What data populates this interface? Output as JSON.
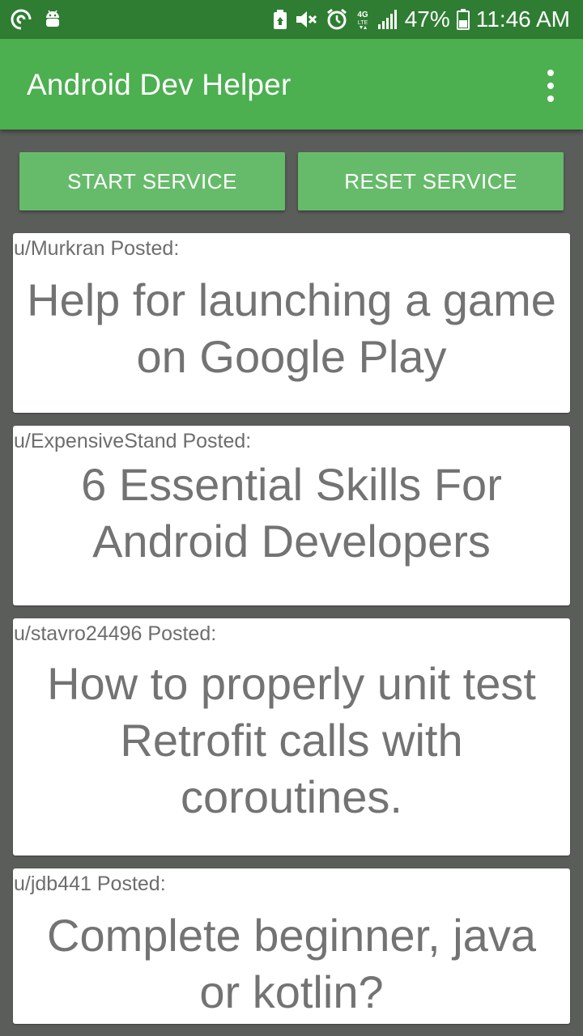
{
  "status_bar": {
    "battery_percent": "47%",
    "time": "11:46 AM",
    "network_label": "4G LTE",
    "left_icons": [
      "sync-icon",
      "android-icon"
    ],
    "right_icons": [
      "battery-saver-icon",
      "mute-icon",
      "alarm-icon",
      "network-type-icon",
      "signal-icon",
      "battery-icon"
    ]
  },
  "app_bar": {
    "title": "Android Dev Helper",
    "menu_icon": "overflow-menu-icon"
  },
  "actions": {
    "start_label": "START SERVICE",
    "reset_label": "RESET SERVICE"
  },
  "posts": [
    {
      "author": "u/Murkran Posted:",
      "title": "Help for launching a game on Google Play"
    },
    {
      "author": "u/ExpensiveStand Posted:",
      "title": "6 Essential Skills For Android Developers"
    },
    {
      "author": "u/stavro24496 Posted:",
      "title": "How to properly unit test Retrofit calls with coroutines."
    },
    {
      "author": "u/jdb441 Posted:",
      "title": "Complete beginner, java or kotlin?"
    }
  ],
  "colors": {
    "status_bar": "#2e7d32",
    "app_bar": "#4caf50",
    "button": "#66bb6a",
    "background": "#5b5d5b",
    "card": "#ffffff",
    "text_gray": "#737373"
  }
}
